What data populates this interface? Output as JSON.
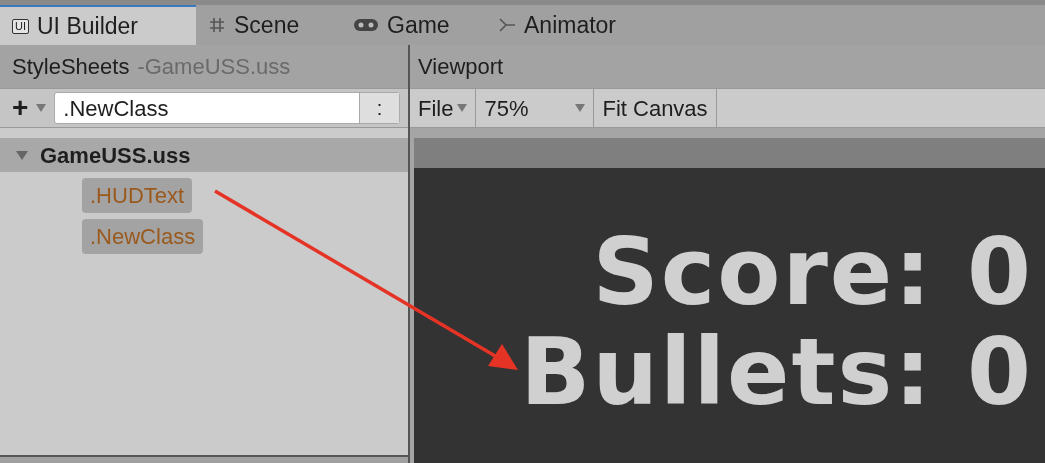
{
  "tabs": [
    {
      "label": "UI Builder",
      "kind": "builder",
      "icon_text": "UI",
      "selected": true
    },
    {
      "label": "Scene",
      "kind": "scene",
      "selected": false
    },
    {
      "label": "Game",
      "kind": "game",
      "selected": false
    },
    {
      "label": "Animator",
      "kind": "animator",
      "selected": false
    }
  ],
  "stylesheets": {
    "title": "StyleSheets",
    "subtitle": "-GameUSS.uss",
    "add_button": "+",
    "selector_field": {
      "value": ".NewClass"
    },
    "pseudo_button": ":",
    "tree": [
      {
        "label": "GameUSS.uss",
        "expanded": true,
        "children": [
          {
            "label": ".HUDText"
          },
          {
            "label": ".NewClass"
          }
        ]
      }
    ]
  },
  "viewport": {
    "title": "Viewport",
    "file_menu": "File",
    "zoom": "75%",
    "fit_button": "Fit Canvas",
    "canvas_texts": [
      {
        "label": "Score: 0"
      },
      {
        "label": "Bullets: 0"
      }
    ]
  }
}
